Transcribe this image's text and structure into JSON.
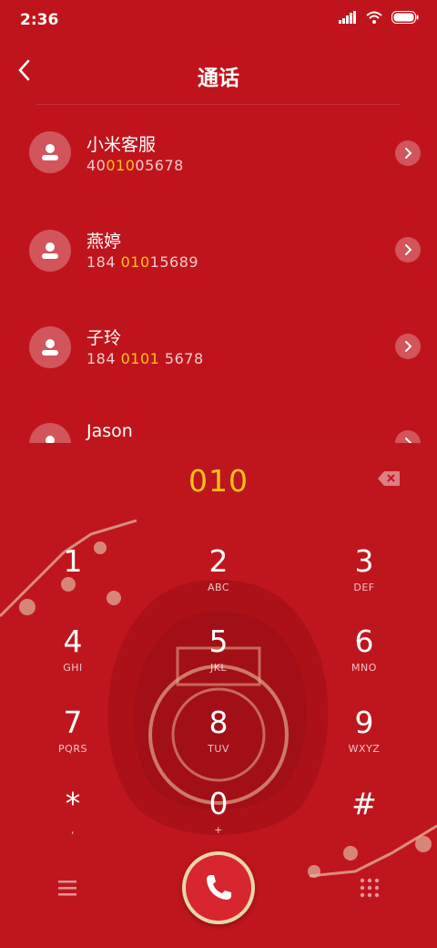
{
  "status": {
    "time": "2:36"
  },
  "header": {
    "title": "通话"
  },
  "contacts": [
    {
      "name": "小米客服",
      "num_pre": "40",
      "num_hl": "010",
      "num_post": "05678"
    },
    {
      "name": "燕婷",
      "num_pre": "184 ",
      "num_hl": "010",
      "num_post": "15689"
    },
    {
      "name": "子玲",
      "num_pre": "184 ",
      "num_hl": "0101",
      "num_post": " 5678"
    },
    {
      "name": "Jason",
      "num_pre": "",
      "num_hl": "",
      "num_post": ""
    }
  ],
  "dialpad": {
    "typed": "010",
    "keys": [
      {
        "digit": "1",
        "letters": ""
      },
      {
        "digit": "2",
        "letters": "ABC"
      },
      {
        "digit": "3",
        "letters": "DEF"
      },
      {
        "digit": "4",
        "letters": "GHI"
      },
      {
        "digit": "5",
        "letters": "JKL"
      },
      {
        "digit": "6",
        "letters": "MNO"
      },
      {
        "digit": "7",
        "letters": "PQRS"
      },
      {
        "digit": "8",
        "letters": "TUV"
      },
      {
        "digit": "9",
        "letters": "WXYZ"
      },
      {
        "digit": "*",
        "letters": ","
      },
      {
        "digit": "0",
        "letters": "+"
      },
      {
        "digit": "#",
        "letters": ""
      }
    ]
  },
  "colors": {
    "background": "#c0141c",
    "highlight": "#ffc21a",
    "accent": "#e9d6a8"
  },
  "icons": [
    "back-arrow-icon",
    "contact-avatar-icon",
    "chevron-right-icon",
    "delete-icon",
    "menu-icon",
    "phone-icon",
    "dialpad-grid-icon"
  ]
}
